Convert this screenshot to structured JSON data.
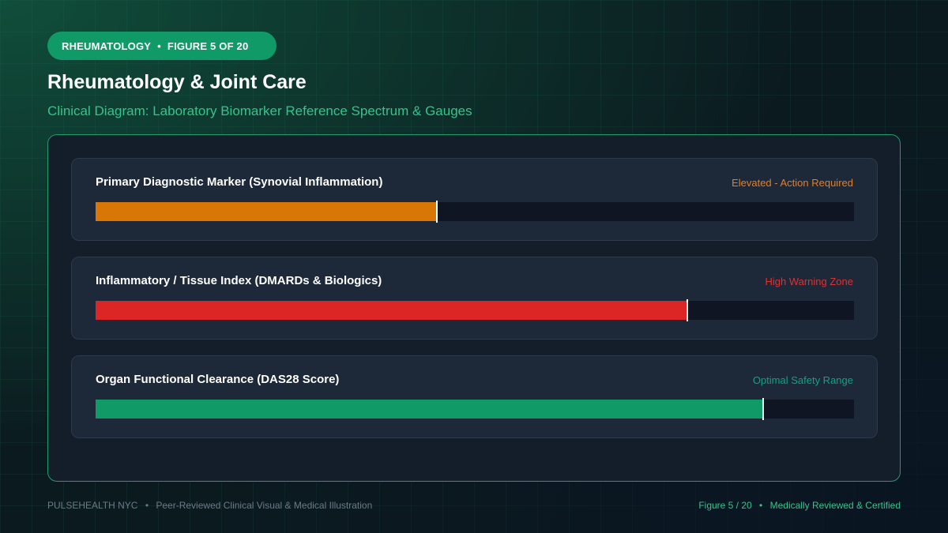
{
  "header": {
    "badge_category": "RHEUMATOLOGY",
    "badge_separator": "•",
    "badge_figure": "FIGURE 5 OF 20",
    "title": "Rheumatology & Joint Care",
    "subtitle": "Clinical Diagram: Laboratory Biomarker Reference Spectrum & Gauges"
  },
  "gauges": [
    {
      "label": "Primary Diagnostic Marker (Synovial Inflammation)",
      "status": "Elevated - Action Required",
      "status_color": "#e67e22",
      "fill_color": "#d97706",
      "level": 0.45
    },
    {
      "label": "Inflammatory / Tissue Index (DMARDs & Biologics)",
      "status": "High Warning Zone",
      "status_color": "#e03131",
      "fill_color": "#dc2626",
      "level": 0.78
    },
    {
      "label": "Organ Functional Clearance (DAS28 Score)",
      "status": "Optimal Safety Range",
      "status_color": "#10a37f",
      "fill_color": "#0f9a68",
      "level": 0.88
    }
  ],
  "footer": {
    "brand": "PULSEHEALTH NYC",
    "separator": "•",
    "tagline": "Peer-Reviewed Clinical Visual & Medical Illustration",
    "figure_ref": "Figure 5 / 20",
    "certification": "Medically Reviewed & Certified"
  }
}
